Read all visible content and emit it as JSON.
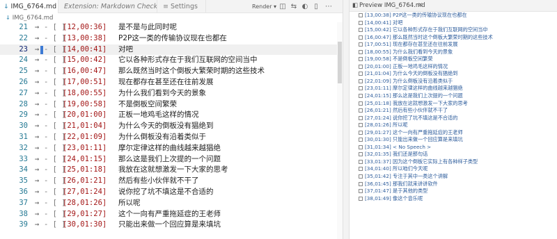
{
  "editor": {
    "tabs": [
      {
        "label": "IMG_6764.md",
        "dirty": "6",
        "icon": "markdown-icon"
      },
      {
        "label": "Extension: Markdown Checkbox",
        "icon": "extension-icon"
      },
      {
        "label": "Settings",
        "icon": "settings-icon"
      }
    ],
    "render_label": "Render",
    "breadcrumb": "IMG_6764.md",
    "lines": [
      {
        "num": "21",
        "box": "- [ ]",
        "ts": "[12,00:36]",
        "text": "是不是与此同时呢"
      },
      {
        "num": "22",
        "box": "- [ ]",
        "ts": "[13,00:38]",
        "text": "P2P这一类的传输协议现在也都在"
      },
      {
        "num": "23",
        "box": "- [ ]",
        "ts": "[14,00:41]",
        "text": "对吧"
      },
      {
        "num": "24",
        "box": "- [ ]",
        "ts": "[15,00:42]",
        "text": "它以各种形式存在于我们互联网的空间当中"
      },
      {
        "num": "25",
        "box": "- [ ]",
        "ts": "[16,00:47]",
        "text": "那么既然当时这个倒板大繁荣时期的这些技术"
      },
      {
        "num": "26",
        "box": "- [ ]",
        "ts": "[17,00:51]",
        "text": "现在都存在甚至还在往前发展"
      },
      {
        "num": "27",
        "box": "- [ ]",
        "ts": "[18,00:55]",
        "text": "为什么我们看到今天的景象"
      },
      {
        "num": "28",
        "box": "- [ ]",
        "ts": "[19,00:58]",
        "text": "不是倒板空间繁荣"
      },
      {
        "num": "29",
        "box": "- [ ]",
        "ts": "[20,01:00]",
        "text": "正板一地鸡毛这样的情况"
      },
      {
        "num": "30",
        "box": "- [ ]",
        "ts": "[21,01:04]",
        "text": "为什么今天的倒板没有猖绝到"
      },
      {
        "num": "31",
        "box": "- [ ]",
        "ts": "[22,01:09]",
        "text": "为什么倒板没有沿着类似于"
      },
      {
        "num": "32",
        "box": "- [ ]",
        "ts": "[23,01:11]",
        "text": "摩尔定律这样的曲线越来越猖绝"
      },
      {
        "num": "33",
        "box": "- [ ]",
        "ts": "[24,01:15]",
        "text": "那么这是我们上次提的一个问题"
      },
      {
        "num": "34",
        "box": "- [ ]",
        "ts": "[25,01:18]",
        "text": "我放在这就想激发一下大家的思考"
      },
      {
        "num": "35",
        "box": "- [ ]",
        "ts": "[26,01:21]",
        "text": "然后有些小伙伴就不干了"
      },
      {
        "num": "36",
        "box": "- [ ]",
        "ts": "[27,01:24]",
        "text": "说你挖了坑不填这是不合适的"
      },
      {
        "num": "37",
        "box": "- [ ]",
        "ts": "[28,01:26]",
        "text": "所以呢"
      },
      {
        "num": "38",
        "box": "- [ ]",
        "ts": "[29,01:27]",
        "text": "这个一向有严重拖延症的王老师"
      },
      {
        "num": "39",
        "box": "- [ ]",
        "ts": "[30,01:30]",
        "text": "只能出来做一个回应算是来填坑"
      }
    ]
  },
  "preview": {
    "tab_label": "Preview IMG_6764.md",
    "items": [
      "[13,00:38] P2P这一类的传输协议现在也都在",
      "[14,00:41] 对吧",
      "[15,00:42] 它以各种形式存在于我们互联网的空间当中",
      "[16,00:47] 那么既然当时这个倒板大繁荣时期的这些技术",
      "[17,00:51] 现在都存在甚至还在往前发展",
      "[18,00:55] 为什么我们看到今天的景象",
      "[19,00:58] 不是倒板空间繁荣",
      "[20,01:00] 正板一地鸡毛这样的情况",
      "[21,01:04] 为什么今天的倒板没有猖绝到",
      "[22,01:09] 为什么倒板没有沿着类似于",
      "[23,01:11] 摩尔定律这样的曲线越来越猖绝",
      "[24,01:15] 那么这是我们上次提的一个问题",
      "[25,01:18] 我放在这就想激发一下大家的思考",
      "[26,01:21] 然后有些小伙伴就不干了",
      "[27,01:24] 说你挖了坑不填这是不合适的",
      "[28,01:26] 所以呢",
      "[29,01:27] 这个一向有严重拖延症的王老师",
      "[30,01:30] 只能出来做一个回应算是来填坑",
      "[31,01:34] < No Speech >",
      "[32,01:35] 我们还是那句话",
      "[33,01:37] 因为这个倒板它实际上有各种样子类型",
      "[34,01:40] 所以咱们今天呢",
      "[35,01:42] 专注于其中一类这个讲解",
      "[36,01:45] 那我们就来讲讲软件",
      "[37,01:47] 是于其他的类型",
      "[38,01:49] 像这个音乐呢"
    ]
  },
  "colors": {
    "line_number": "#237893",
    "timestamp": "#a31515",
    "preview_text": "#2e5d9c",
    "caret": "#3d7ad4"
  }
}
